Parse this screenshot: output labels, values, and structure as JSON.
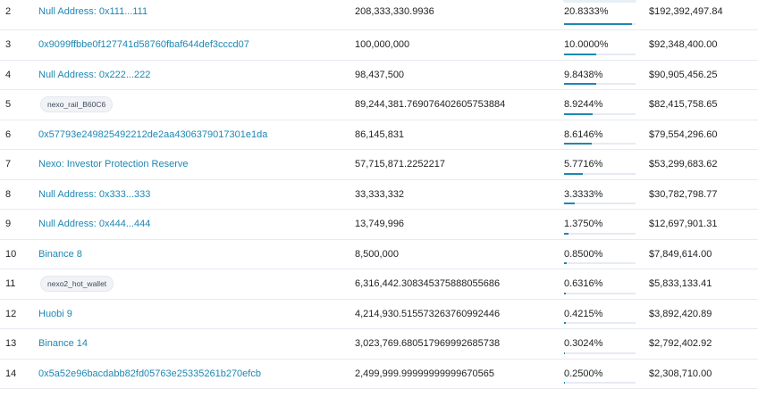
{
  "holders": [
    {
      "rank": "2",
      "address": "Null Address: 0x111...111",
      "is_tag": false,
      "quantity": "208,333,330.9936",
      "percentage": "20.8333%",
      "pct_value": 20.8333,
      "value": "$192,392,497.84"
    },
    {
      "rank": "3",
      "address": "0x9099ffbbe0f127741d58760fbaf644def3cccd07",
      "is_tag": false,
      "quantity": "100,000,000",
      "percentage": "10.0000%",
      "pct_value": 10.0,
      "value": "$92,348,400.00"
    },
    {
      "rank": "4",
      "address": "Null Address: 0x222...222",
      "is_tag": false,
      "quantity": "98,437,500",
      "percentage": "9.8438%",
      "pct_value": 9.8438,
      "value": "$90,905,456.25"
    },
    {
      "rank": "5",
      "address": "nexo_rail_B60C6",
      "is_tag": true,
      "quantity": "89,244,381.769076402605753884",
      "percentage": "8.9244%",
      "pct_value": 8.9244,
      "value": "$82,415,758.65"
    },
    {
      "rank": "6",
      "address": "0x57793e249825492212de2aa4306379017301e1da",
      "is_tag": false,
      "quantity": "86,145,831",
      "percentage": "8.6146%",
      "pct_value": 8.6146,
      "value": "$79,554,296.60"
    },
    {
      "rank": "7",
      "address": "Nexo: Investor Protection Reserve",
      "is_tag": false,
      "quantity": "57,715,871.2252217",
      "percentage": "5.7716%",
      "pct_value": 5.7716,
      "value": "$53,299,683.62"
    },
    {
      "rank": "8",
      "address": "Null Address: 0x333...333",
      "is_tag": false,
      "quantity": "33,333,332",
      "percentage": "3.3333%",
      "pct_value": 3.3333,
      "value": "$30,782,798.77"
    },
    {
      "rank": "9",
      "address": "Null Address: 0x444...444",
      "is_tag": false,
      "quantity": "13,749,996",
      "percentage": "1.3750%",
      "pct_value": 1.375,
      "value": "$12,697,901.31"
    },
    {
      "rank": "10",
      "address": "Binance 8",
      "is_tag": false,
      "quantity": "8,500,000",
      "percentage": "0.8500%",
      "pct_value": 0.85,
      "value": "$7,849,614.00"
    },
    {
      "rank": "11",
      "address": "nexo2_hot_wallet",
      "is_tag": true,
      "quantity": "6,316,442.308345375888055686",
      "percentage": "0.6316%",
      "pct_value": 0.6316,
      "value": "$5,833,133.41"
    },
    {
      "rank": "12",
      "address": "Huobi 9",
      "is_tag": false,
      "quantity": "4,214,930.515573263760992446",
      "percentage": "0.4215%",
      "pct_value": 0.4215,
      "value": "$3,892,420.89"
    },
    {
      "rank": "13",
      "address": "Binance 14",
      "is_tag": false,
      "quantity": "3,023,769.680517969992685738",
      "percentage": "0.3024%",
      "pct_value": 0.3024,
      "value": "$2,792,402.92"
    },
    {
      "rank": "14",
      "address": "0x5a52e96bacdabb82fd05763e25335261b270efcb",
      "is_tag": false,
      "quantity": "2,499,999.99999999999670565",
      "percentage": "0.2500%",
      "pct_value": 0.25,
      "value": "$2,308,710.00"
    }
  ],
  "colors": {
    "link": "#1e87b3",
    "bar_fill": "#1e87b3",
    "bar_track": "#e7eaf3",
    "row_divider": "#e7eaf3"
  }
}
